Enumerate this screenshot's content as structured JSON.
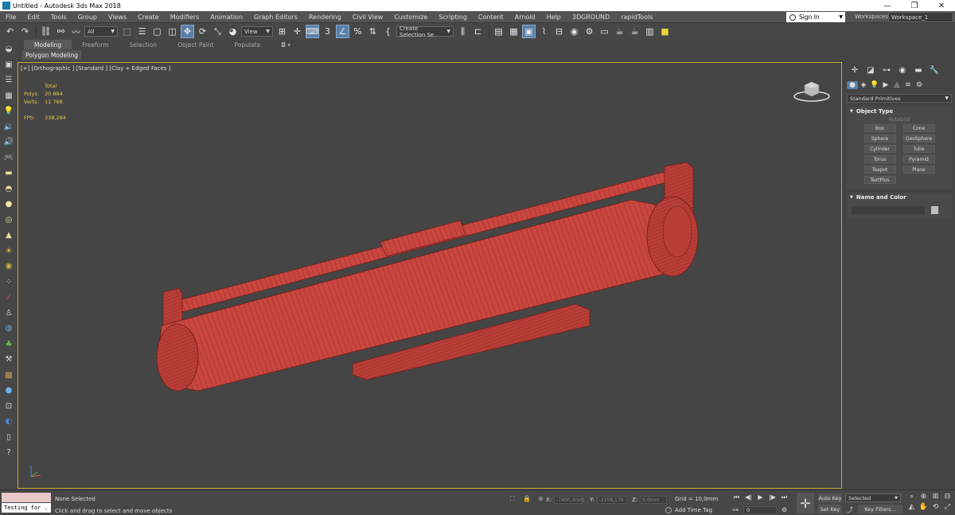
{
  "window": {
    "title": "Untitled - Autodesk 3ds Max 2018",
    "minimize": "—",
    "restore": "❐",
    "close": "✕"
  },
  "menu": [
    "File",
    "Edit",
    "Tools",
    "Group",
    "Views",
    "Create",
    "Modifiers",
    "Animation",
    "Graph Editors",
    "Rendering",
    "Civil View",
    "Customize",
    "Scripting",
    "Content",
    "Arnold",
    "Help",
    "3DGROUND",
    "rapidTools"
  ],
  "account": {
    "sign_in": "Sign In",
    "workspaces_label": "Workspaces:",
    "workspace": "Workspace_1"
  },
  "toolbar": {
    "selection_filter": "All",
    "ref_coord": "View",
    "snap_3": "3",
    "named_selection": "Create Selection Se"
  },
  "ribbon": {
    "tabs": [
      "Modeling",
      "Freeform",
      "Selection",
      "Object Paint",
      "Populate"
    ],
    "active_tab": "Modeling",
    "sub_panel": "Polygon Modeling"
  },
  "viewport": {
    "label": "[+] [Orthographic ] [Standard ] [Clay + Edged Faces ]",
    "stats": {
      "total_label": "Total",
      "polys_label": "Polys:",
      "polys": "20 884",
      "verts_label": "Verts:",
      "verts": "11 768",
      "fps_label": "FPS:",
      "fps": "338,284"
    },
    "model_color": "#c8463f",
    "border_color": "#c9a63a"
  },
  "command_panel": {
    "category": "Standard Primitives",
    "object_type_title": "Object Type",
    "autogrid": "AutoGrid",
    "objects": [
      "Box",
      "Cone",
      "Sphere",
      "GeoSphere",
      "Cylinder",
      "Tube",
      "Torus",
      "Pyramid",
      "Teapot",
      "Plane",
      "TextPlus"
    ],
    "name_color_title": "Name and Color"
  },
  "status": {
    "maxscript_text": "Testing for .",
    "selection": "None Selected",
    "prompt": "Click and drag to select and move objects",
    "x_label": "X:",
    "x_value": "-7400,3mm",
    "y_label": "Y:",
    "y_value": "-2158,176",
    "z_label": "Z:",
    "z_value": "0,0mm",
    "grid": "Grid = 10,0mm",
    "add_time_tag": "Add Time Tag",
    "frame": "0",
    "auto_key": "Auto Key",
    "set_key": "Set Key",
    "key_mode": "Selected",
    "key_filters": "Key Filters..."
  }
}
